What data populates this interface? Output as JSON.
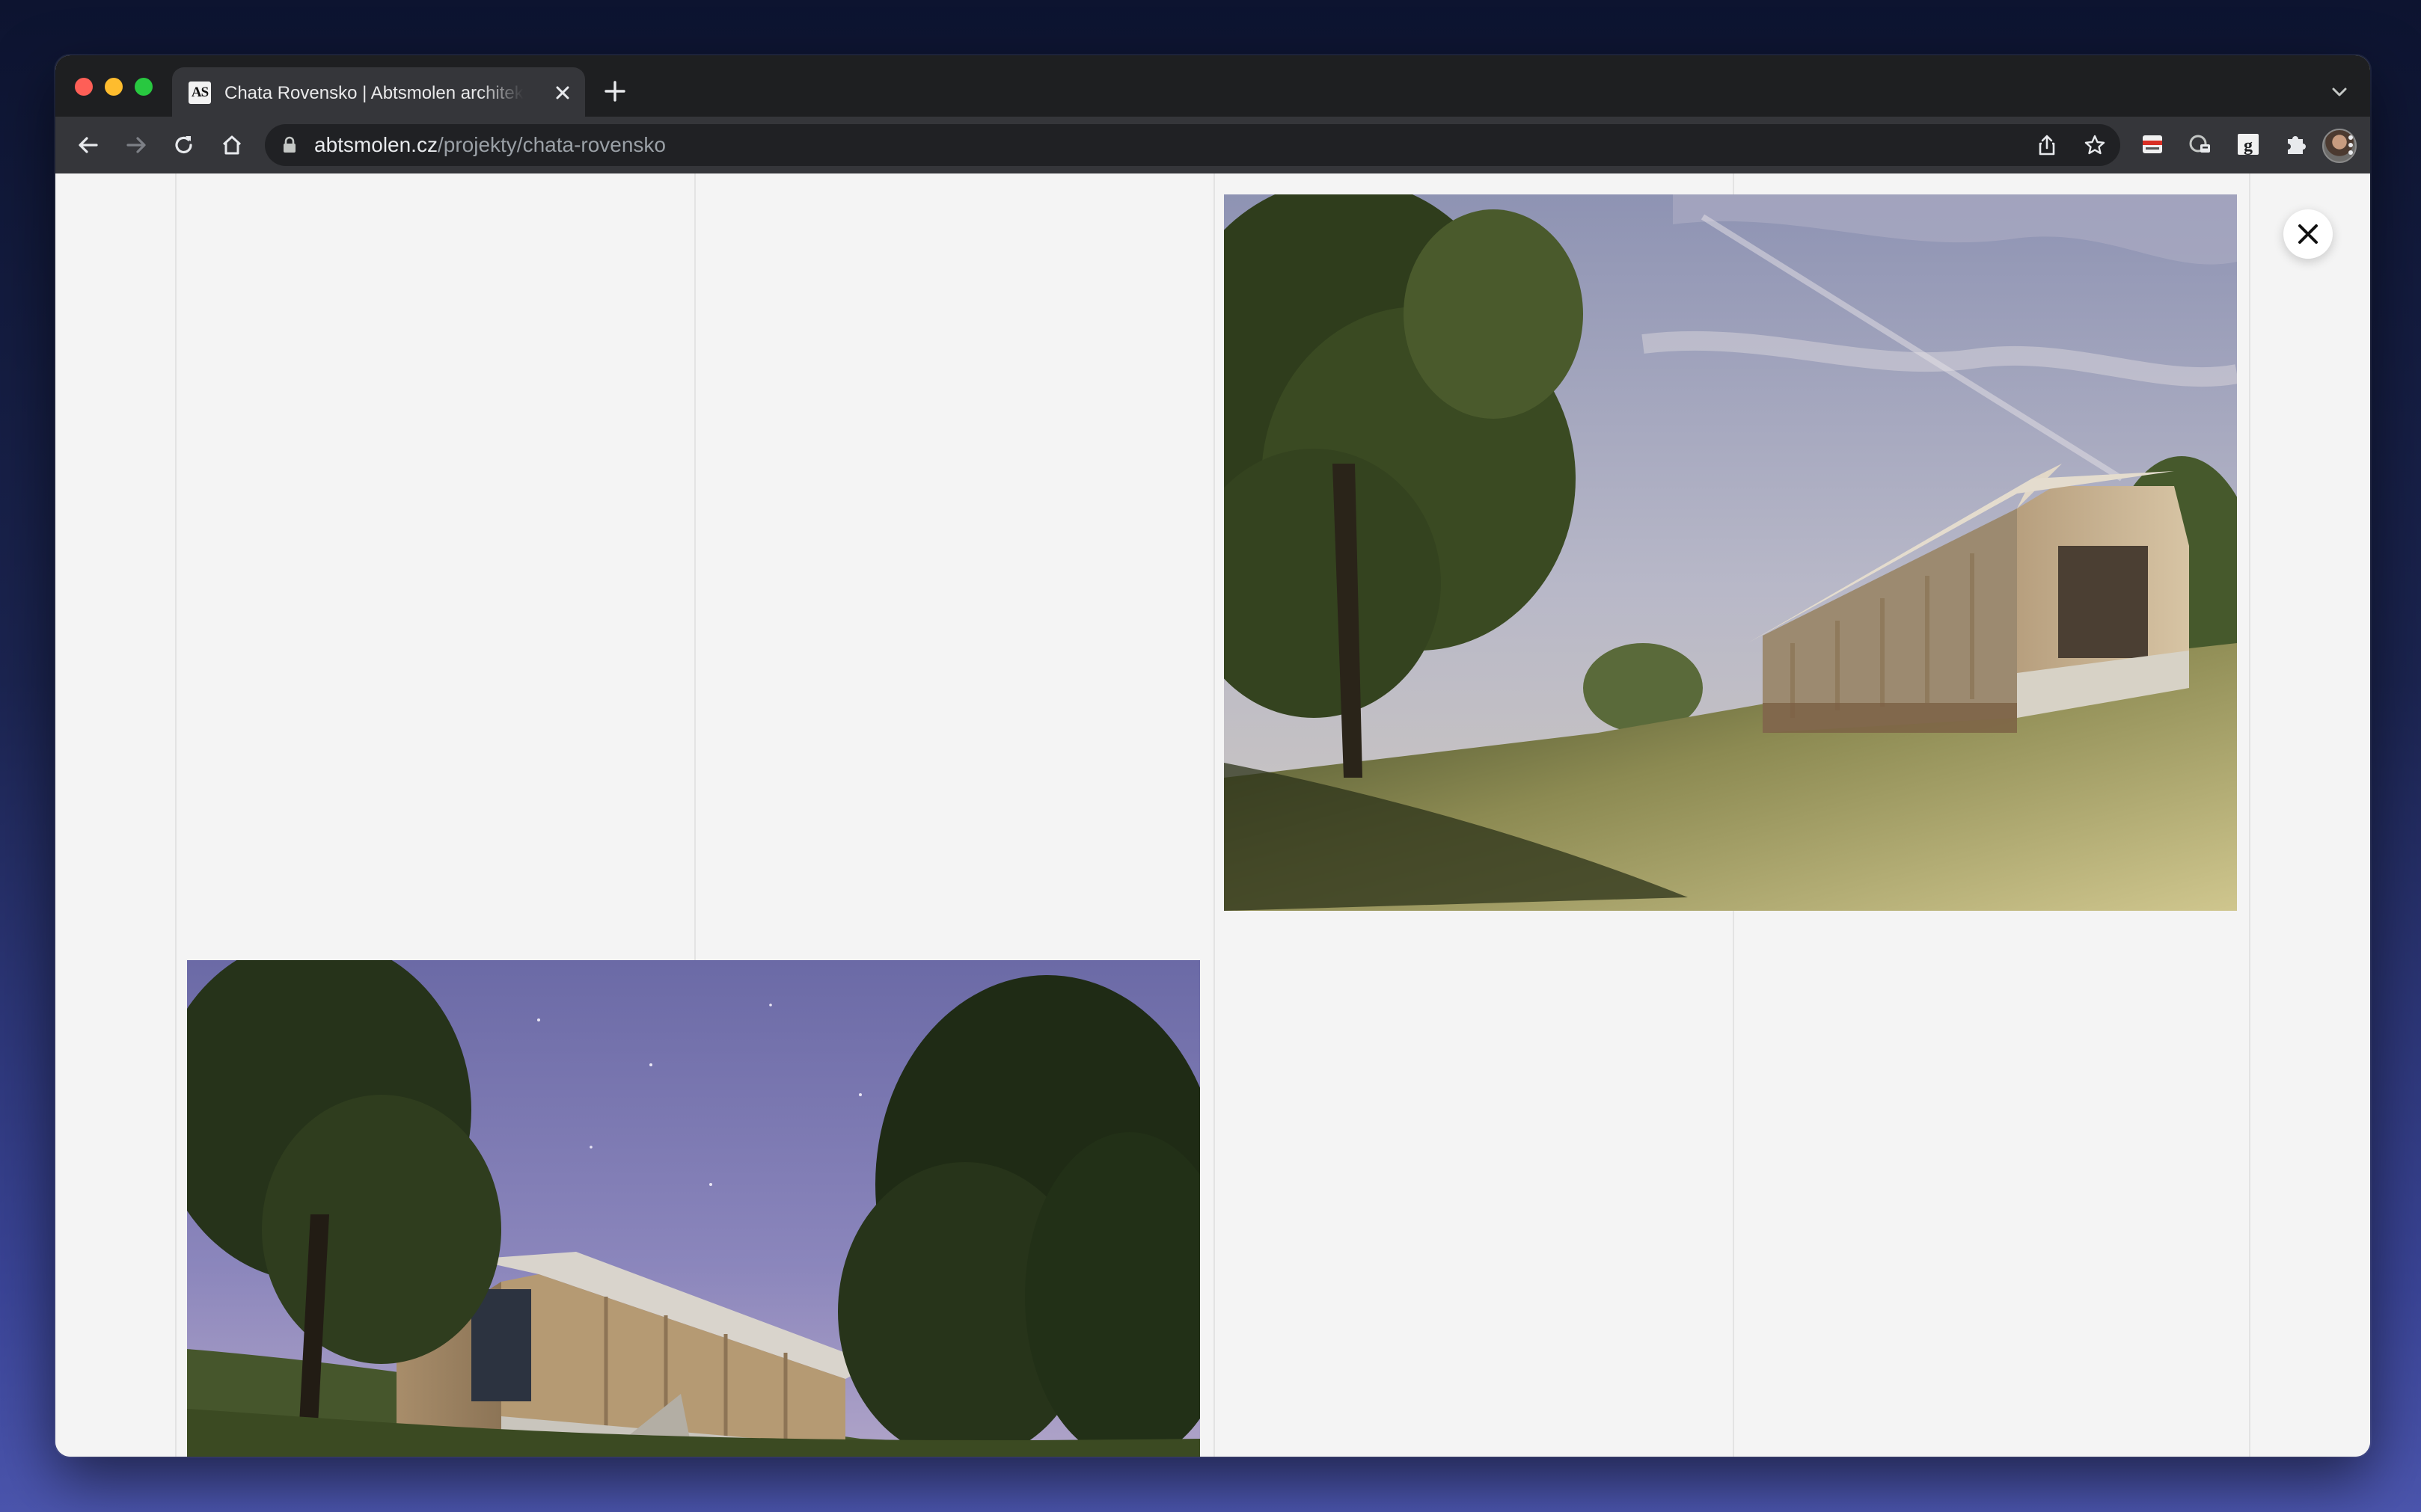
{
  "browser": {
    "tab": {
      "favicon_text": "AS",
      "title": "Chata Rovensko | Abtsmolen architekti"
    },
    "address_bar": {
      "host": "abtsmolen.cz",
      "path": "/projekty/chata-rovensko"
    },
    "icons": {
      "traffic_lights": [
        "close-window",
        "minimize-window",
        "zoom-window"
      ],
      "navigation": [
        "back-arrow",
        "forward-arrow",
        "reload",
        "home"
      ],
      "omnibox": [
        "lock",
        "share",
        "bookmark-star"
      ],
      "extensions": [
        "extension-red-bar",
        "extension-shield",
        "extension-g",
        "puzzle-piece"
      ],
      "menu": "three-dot-menu"
    }
  },
  "gallery": {
    "photos": [
      {
        "subject": "timber cabin on grassy hillside under daytime sky"
      },
      {
        "subject": "timber cabin at dusk among trees"
      }
    ],
    "close_label": "close gallery"
  },
  "colors": {
    "chrome_dark": "#1e1f21",
    "toolbar": "#35363a",
    "page_background": "#f4f4f4"
  }
}
